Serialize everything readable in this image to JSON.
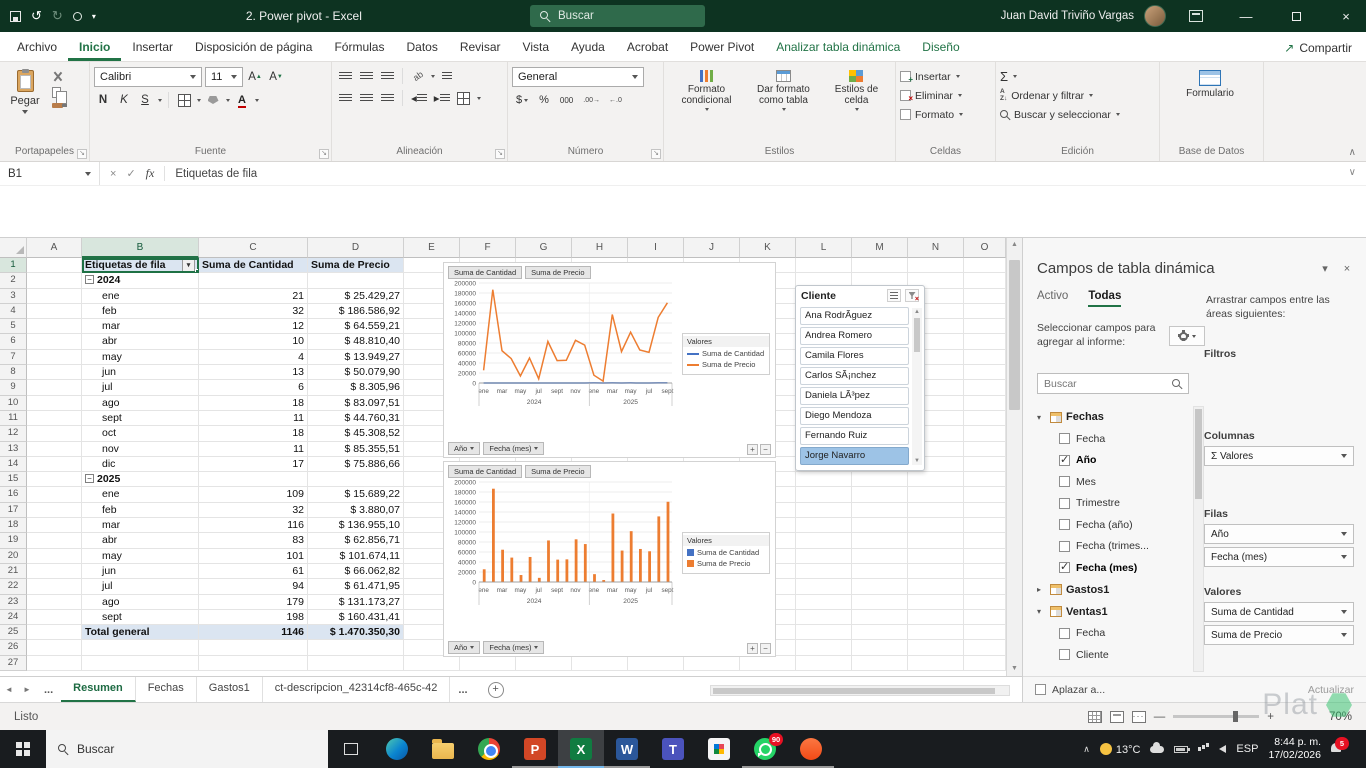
{
  "titlebar": {
    "title": "2. Power pivot  -  Excel",
    "search_placeholder": "Buscar",
    "user_name": "Juan David Triviño Vargas"
  },
  "ribbon": {
    "tabs": [
      {
        "label": "Archivo"
      },
      {
        "label": "Inicio",
        "style": "active"
      },
      {
        "label": "Insertar"
      },
      {
        "label": "Disposición de página"
      },
      {
        "label": "Fórmulas"
      },
      {
        "label": "Datos"
      },
      {
        "label": "Revisar"
      },
      {
        "label": "Vista"
      },
      {
        "label": "Ayuda"
      },
      {
        "label": "Acrobat"
      },
      {
        "label": "Power Pivot"
      },
      {
        "label": "Analizar tabla dinámica",
        "style": "contextual"
      },
      {
        "label": "Diseño",
        "style": "contextual"
      }
    ],
    "share_label": "Compartir",
    "clipboard": {
      "label": "Portapapeles",
      "paste": "Pegar"
    },
    "font": {
      "label": "Fuente",
      "name": "Calibri",
      "size": "11",
      "bold": "N",
      "italic": "K",
      "underline": "S"
    },
    "alignment": {
      "label": "Alineación"
    },
    "number": {
      "label": "Número",
      "format": "General",
      "currency": "$",
      "percent": "%",
      "thousands": "000",
      "inc_dec": ".00→",
      "dec_dec": "←.0"
    },
    "styles": {
      "label": "Estilos",
      "items": [
        "Formato condicional",
        "Dar formato como tabla",
        "Estilos de celda"
      ]
    },
    "cells": {
      "label": "Celdas",
      "items": [
        "Insertar",
        "Eliminar",
        "Formato"
      ]
    },
    "editing": {
      "label": "Edición",
      "sum": "Σ",
      "items": [
        "Ordenar y filtrar",
        "Buscar y seleccionar"
      ]
    },
    "database": {
      "label": "Base de Datos",
      "button": "Formulario"
    }
  },
  "formula_bar": {
    "cell_ref": "B1",
    "fx": "fx",
    "value": "Etiquetas de fila"
  },
  "sheet": {
    "col_letters": [
      "A",
      "B",
      "C",
      "D",
      "E",
      "F",
      "G",
      "H",
      "I",
      "J",
      "K",
      "L",
      "M",
      "N",
      "O"
    ],
    "header": {
      "rows_label": "Etiquetas de fila",
      "qty": "Suma de Cantidad",
      "price": "Suma de Precio"
    },
    "rows": [
      {
        "type": "year",
        "label": "2024"
      },
      {
        "type": "data",
        "label": "ene",
        "qty": "21",
        "price": "$ 25.429,27"
      },
      {
        "type": "data",
        "label": "feb",
        "qty": "32",
        "price": "$ 186.586,92"
      },
      {
        "type": "data",
        "label": "mar",
        "qty": "12",
        "price": "$ 64.559,21"
      },
      {
        "type": "data",
        "label": "abr",
        "qty": "10",
        "price": "$ 48.810,40"
      },
      {
        "type": "data",
        "label": "may",
        "qty": "4",
        "price": "$ 13.949,27"
      },
      {
        "type": "data",
        "label": "jun",
        "qty": "13",
        "price": "$ 50.079,90"
      },
      {
        "type": "data",
        "label": "jul",
        "qty": "6",
        "price": "$ 8.305,96"
      },
      {
        "type": "data",
        "label": "ago",
        "qty": "18",
        "price": "$ 83.097,51"
      },
      {
        "type": "data",
        "label": "sept",
        "qty": "11",
        "price": "$ 44.760,31"
      },
      {
        "type": "data",
        "label": "oct",
        "qty": "18",
        "price": "$ 45.308,52"
      },
      {
        "type": "data",
        "label": "nov",
        "qty": "11",
        "price": "$ 85.355,51"
      },
      {
        "type": "data",
        "label": "dic",
        "qty": "17",
        "price": "$ 75.886,66"
      },
      {
        "type": "year",
        "label": "2025"
      },
      {
        "type": "data",
        "label": "ene",
        "qty": "109",
        "price": "$ 15.689,22"
      },
      {
        "type": "data",
        "label": "feb",
        "qty": "32",
        "price": "$ 3.880,07"
      },
      {
        "type": "data",
        "label": "mar",
        "qty": "116",
        "price": "$ 136.955,10"
      },
      {
        "type": "data",
        "label": "abr",
        "qty": "83",
        "price": "$ 62.856,71"
      },
      {
        "type": "data",
        "label": "may",
        "qty": "101",
        "price": "$ 101.674,11"
      },
      {
        "type": "data",
        "label": "jun",
        "qty": "61",
        "price": "$ 66.062,82"
      },
      {
        "type": "data",
        "label": "jul",
        "qty": "94",
        "price": "$ 61.471,95"
      },
      {
        "type": "data",
        "label": "ago",
        "qty": "179",
        "price": "$ 131.173,27"
      },
      {
        "type": "data",
        "label": "sept",
        "qty": "198",
        "price": "$ 160.431,41"
      },
      {
        "type": "total",
        "label": "Total general",
        "qty": "1146",
        "price": "$ 1.470.350,30"
      }
    ]
  },
  "slicer": {
    "title": "Cliente",
    "items": [
      {
        "name": "Ana RodrÃ­guez",
        "selected": false
      },
      {
        "name": "Andrea Romero",
        "selected": false
      },
      {
        "name": "Camila Flores",
        "selected": false
      },
      {
        "name": "Carlos SÃ¡nchez",
        "selected": false
      },
      {
        "name": "Daniela LÃ³pez",
        "selected": false
      },
      {
        "name": "Diego Mendoza",
        "selected": false
      },
      {
        "name": "Fernando Ruiz",
        "selected": false
      },
      {
        "name": "Jorge Navarro",
        "selected": true
      }
    ]
  },
  "chart_data": [
    {
      "type": "line",
      "categories": [
        "ene",
        "feb",
        "mar",
        "abr",
        "may",
        "jun",
        "jul",
        "ago",
        "sept",
        "oct",
        "nov",
        "dic",
        "ene",
        "feb",
        "mar",
        "abr",
        "may",
        "jun",
        "jul",
        "ago",
        "sept"
      ],
      "tick_indices": [
        0,
        2,
        4,
        6,
        8,
        10,
        12,
        14,
        16,
        18,
        20
      ],
      "year_split": 12,
      "x_group_labels": [
        "2024",
        "2025"
      ],
      "series": [
        {
          "name": "Suma de Cantidad",
          "color": "#4472c4",
          "values": [
            21,
            32,
            12,
            10,
            4,
            13,
            6,
            18,
            11,
            18,
            11,
            17,
            109,
            32,
            116,
            83,
            101,
            61,
            94,
            179,
            198
          ]
        },
        {
          "name": "Suma de Precio",
          "color": "#ed7d31",
          "values": [
            25429.27,
            186586.92,
            64559.21,
            48810.4,
            13949.27,
            50079.9,
            8305.96,
            83097.51,
            44760.31,
            45308.52,
            85355.51,
            75886.66,
            15689.22,
            3880.07,
            136955.1,
            62856.71,
            101674.11,
            66062.82,
            61471.95,
            131173.27,
            160431.41
          ]
        }
      ],
      "ylim": [
        0,
        200000
      ],
      "ytick_step": 20000,
      "legend_title": "Valores",
      "field_buttons": [
        "Suma de Cantidad",
        "Suma de Precio"
      ],
      "axis_buttons": [
        "Año",
        "Fecha (mes)"
      ]
    },
    {
      "type": "bar",
      "categories": [
        "ene",
        "feb",
        "mar",
        "abr",
        "may",
        "jun",
        "jul",
        "ago",
        "sept",
        "oct",
        "nov",
        "dic",
        "ene",
        "feb",
        "mar",
        "abr",
        "may",
        "jun",
        "jul",
        "ago",
        "sept"
      ],
      "tick_indices": [
        0,
        2,
        4,
        6,
        8,
        10,
        12,
        14,
        16,
        18,
        20
      ],
      "year_split": 12,
      "x_group_labels": [
        "2024",
        "2025"
      ],
      "series": [
        {
          "name": "Suma de Cantidad",
          "color": "#4472c4",
          "values": [
            21,
            32,
            12,
            10,
            4,
            13,
            6,
            18,
            11,
            18,
            11,
            17,
            109,
            32,
            116,
            83,
            101,
            61,
            94,
            179,
            198
          ]
        },
        {
          "name": "Suma de Precio",
          "color": "#ed7d31",
          "values": [
            25429.27,
            186586.92,
            64559.21,
            48810.4,
            13949.27,
            50079.9,
            8305.96,
            83097.51,
            44760.31,
            45308.52,
            85355.51,
            75886.66,
            15689.22,
            3880.07,
            136955.1,
            62856.71,
            101674.11,
            66062.82,
            61471.95,
            131173.27,
            160431.41
          ]
        }
      ],
      "ylim": [
        0,
        200000
      ],
      "ytick_step": 20000,
      "legend_title": "Valores",
      "field_buttons": [
        "Suma de Cantidad",
        "Suma de Precio"
      ],
      "axis_buttons": [
        "Año",
        "Fecha (mes)"
      ]
    }
  ],
  "fields_panel": {
    "title": "Campos de tabla dinámica",
    "tabs": [
      "Activo",
      "Todas"
    ],
    "active_tab": "Todas",
    "select_hint": "Seleccionar campos para agregar al informe:",
    "drag_hint": "Arrastrar campos entre las áreas siguientes:",
    "search_placeholder": "Buscar",
    "tree": [
      {
        "table": "Fechas",
        "expanded": true,
        "fields": [
          {
            "name": "Fecha",
            "checked": false
          },
          {
            "name": "Año",
            "checked": true
          },
          {
            "name": "Mes",
            "checked": false
          },
          {
            "name": "Trimestre",
            "checked": false
          },
          {
            "name": "Fecha (año)",
            "checked": false
          },
          {
            "name": "Fecha (trimes...",
            "checked": false
          },
          {
            "name": "Fecha (mes)",
            "checked": true
          }
        ]
      },
      {
        "table": "Gastos1",
        "expanded": false,
        "fields": []
      },
      {
        "table": "Ventas1",
        "expanded": true,
        "fields": [
          {
            "name": "Fecha",
            "checked": false
          },
          {
            "name": "Cliente",
            "checked": false
          }
        ]
      }
    ],
    "areas": {
      "filtros": {
        "label": "Filtros",
        "pills": []
      },
      "columnas": {
        "label": "Columnas",
        "pills": [
          "Σ Valores"
        ]
      },
      "filas": {
        "label": "Filas",
        "pills": [
          "Año",
          "Fecha (mes)"
        ]
      },
      "valores": {
        "label": "Valores",
        "pills": [
          "Suma de Cantidad",
          "Suma de Precio"
        ]
      }
    },
    "defer_label": "Aplazar a...",
    "update_label": "Actualizar"
  },
  "sheet_tabs": {
    "more_left": "...",
    "tabs": [
      "Resumen",
      "Fechas",
      "Gastos1",
      "ct-descripcion_42314cf8-465c-42"
    ],
    "active": "Resumen",
    "more_right": "..."
  },
  "status_bar": {
    "mode": "Listo",
    "zoom": "70%"
  },
  "taskbar": {
    "search_placeholder": "Buscar",
    "weather": "13°C",
    "lang": "ESP",
    "time": "8:44 p. m.",
    "date": "17/02/2026",
    "whatsapp_badge": "90",
    "notification_badge": "5"
  },
  "watermark": {
    "text": "Plat"
  }
}
